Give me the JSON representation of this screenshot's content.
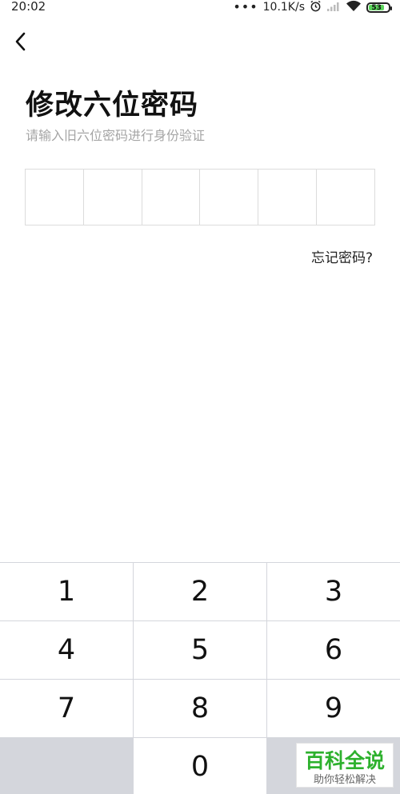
{
  "status_bar": {
    "time": "20:02",
    "dots": "•••",
    "network_speed": "10.1K/s",
    "battery_level": "53",
    "icons": [
      "alarm-icon",
      "signal-icon",
      "wifi-icon",
      "battery-icon"
    ]
  },
  "header": {
    "back_icon": "chevron-left-icon",
    "title": "修改六位密码",
    "subtitle": "请输入旧六位密码进行身份验证"
  },
  "pin": {
    "length": 6,
    "entered": ""
  },
  "forgot_link": "忘记密码?",
  "keypad": {
    "keys": [
      "1",
      "2",
      "3",
      "4",
      "5",
      "6",
      "7",
      "8",
      "9",
      "",
      "0",
      ""
    ]
  },
  "watermark": {
    "main": "百科全说",
    "sub": "助你轻松解决"
  },
  "colors": {
    "background": "#ffffff",
    "subtitle": "#a5a5a5",
    "keypad_bg": "#d4d6dc",
    "watermark_green": "#2db12d"
  }
}
